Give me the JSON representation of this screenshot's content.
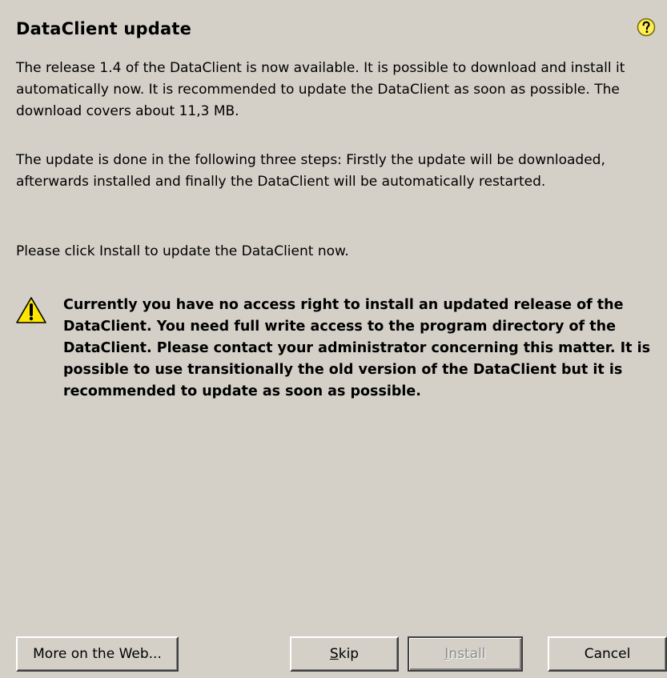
{
  "dialog": {
    "title": "DataClient update",
    "help_icon": "question-mark-icon",
    "paragraphs": [
      "The release 1.4 of the DataClient is now available. It is possible to download and install it automatically now. It is recommended to update the DataClient as soon as possible. The download covers about 11,3 MB.",
      "The update is done in the following three steps: Firstly the update will be downloaded, afterwards installed and finally the DataClient will be automatically restarted.",
      "Please click Install to update the DataClient now."
    ],
    "warning": {
      "icon": "warning-triangle-icon",
      "text": "Currently you have no access right to install an updated release of the DataClient. You need full write access to the program directory of the DataClient. Please contact your administrator concerning this matter. It is possible to use transitionally the old version of the DataClient but it is recommended to update as soon as possible."
    }
  },
  "buttons": {
    "more_label": "More on the Web...",
    "skip_mnemonic": "S",
    "skip_rest": "kip",
    "install_mnemonic": "I",
    "install_rest": "nstall",
    "install_disabled": true,
    "cancel_label": "Cancel"
  },
  "colors": {
    "dialog_background": "#d4d0c8",
    "help_icon_fill": "#ffee55",
    "warning_icon_fill": "#ffe600",
    "disabled_text": "#8c8c8c"
  }
}
